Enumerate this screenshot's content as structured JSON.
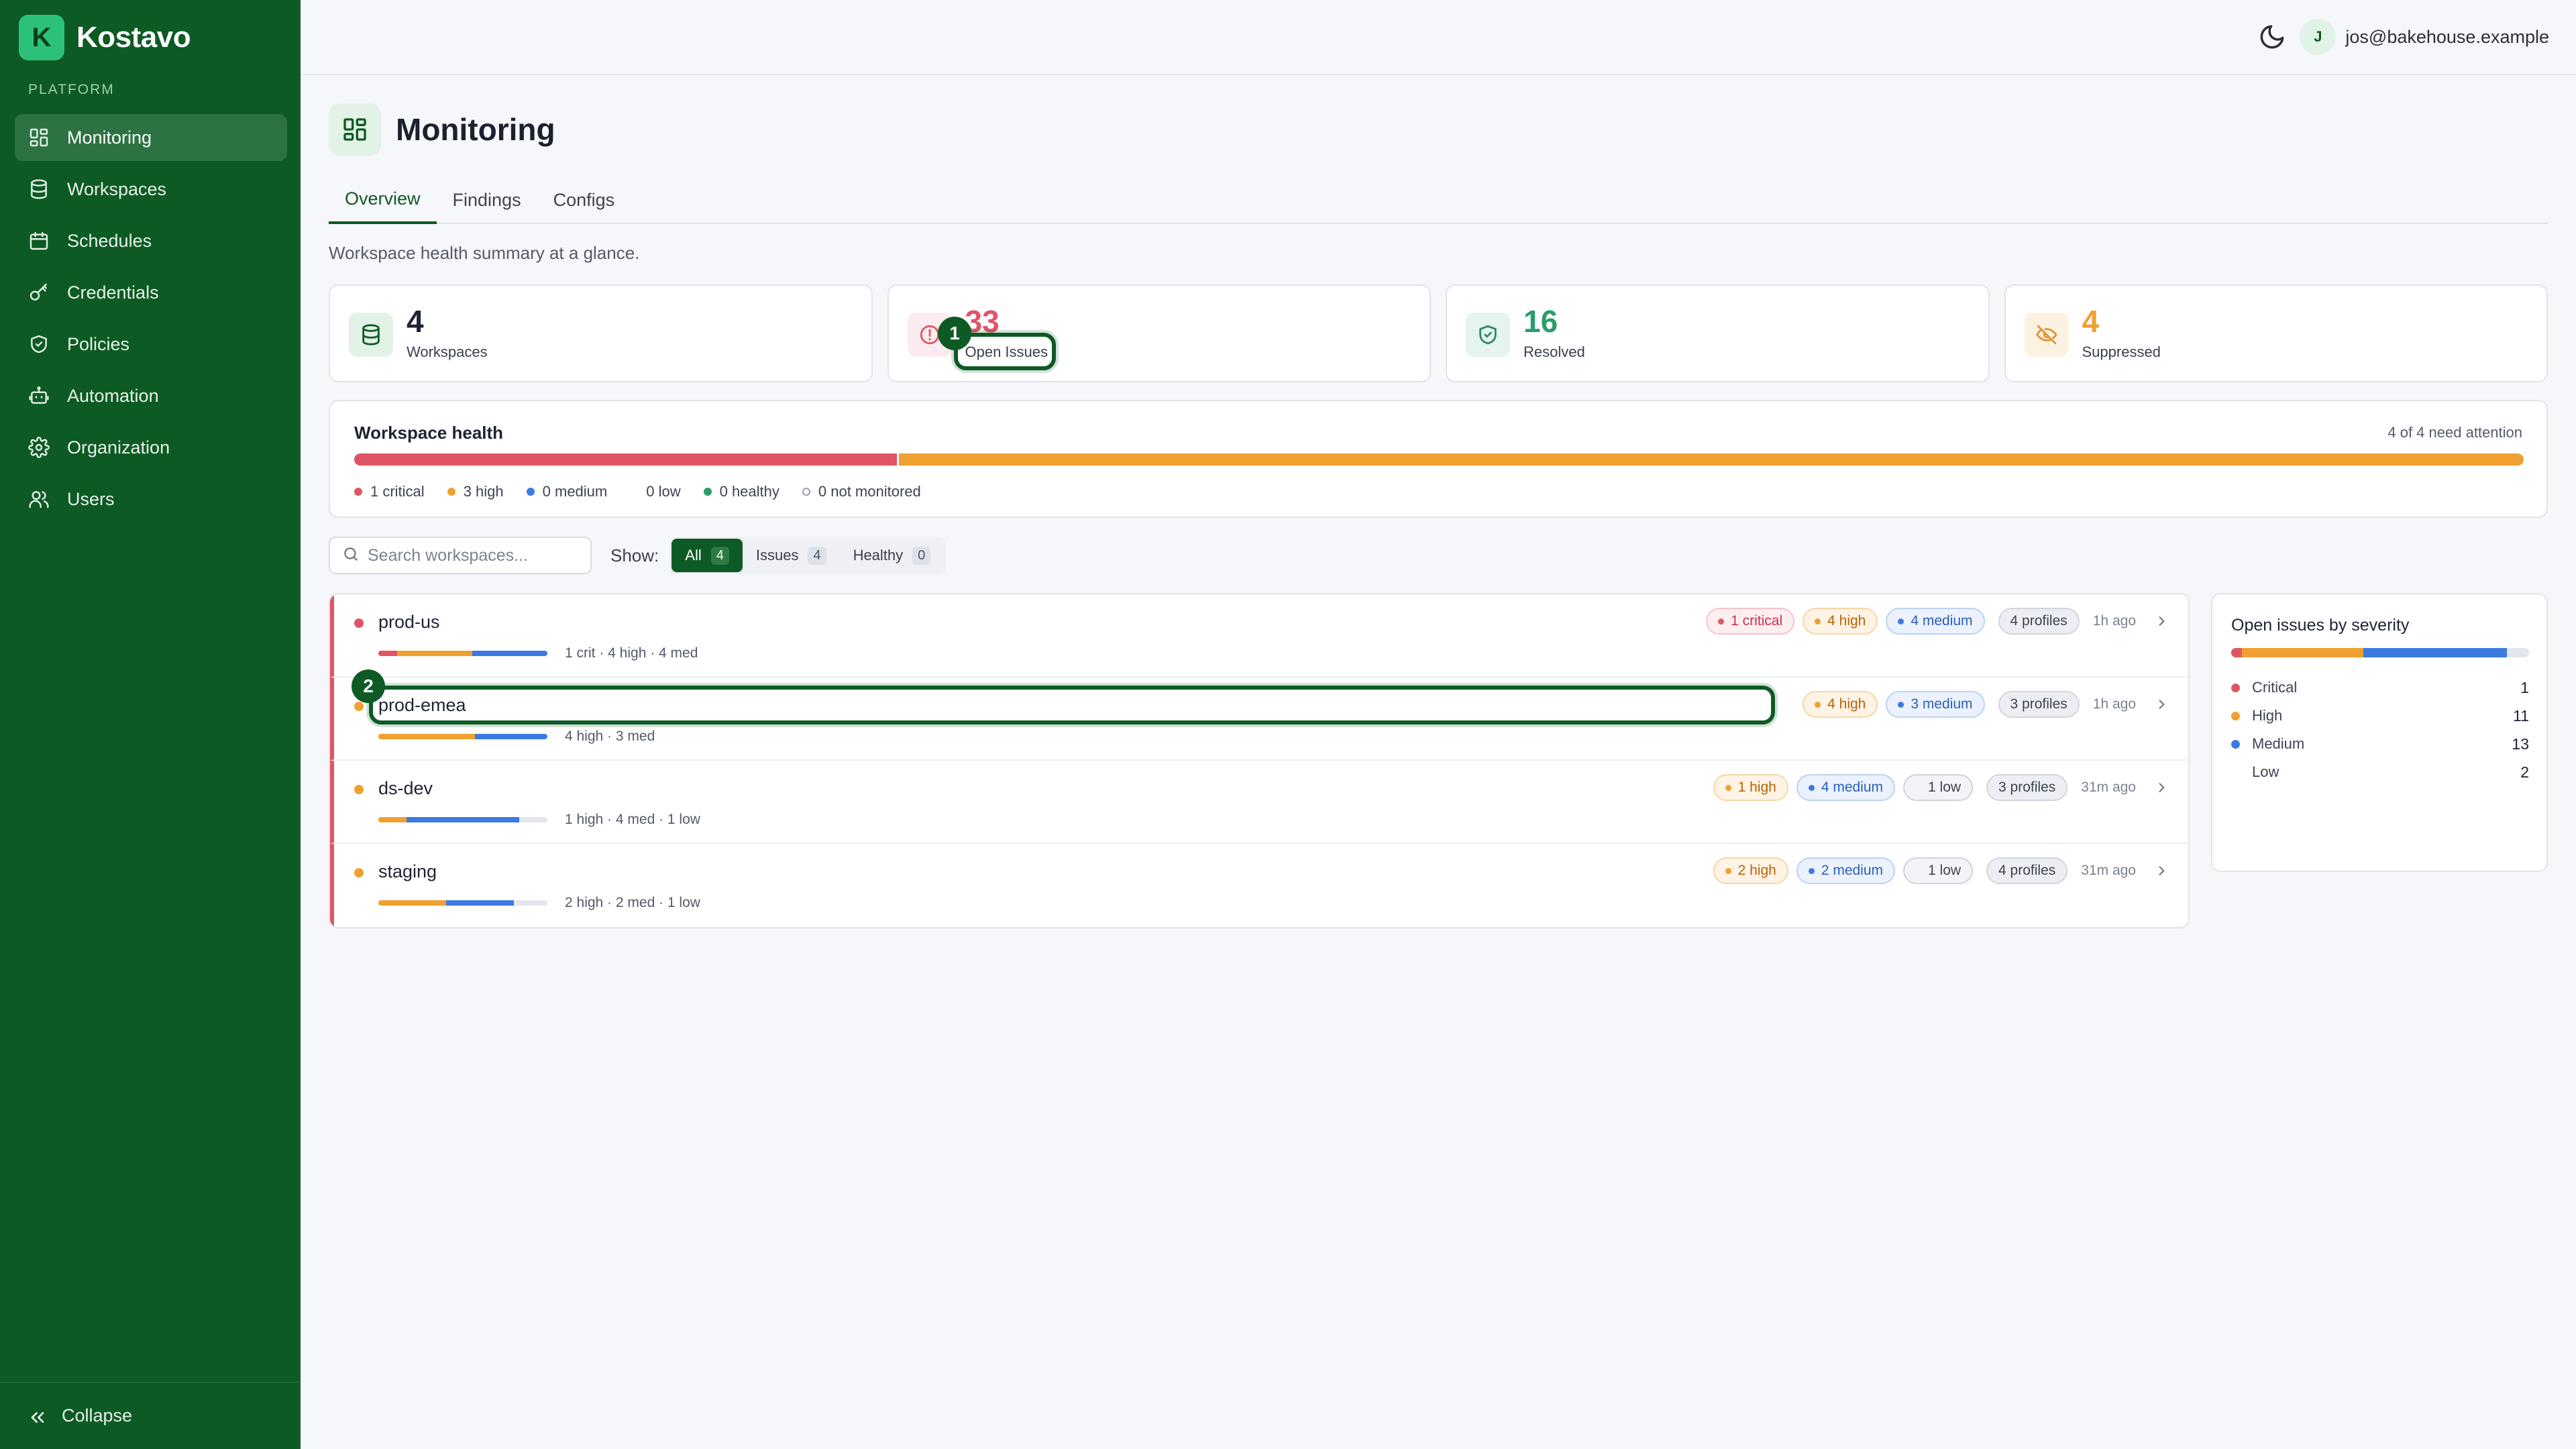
{
  "brand": {
    "logo_letter": "K",
    "name": "Kostavo"
  },
  "sidebar": {
    "section_label": "PLATFORM",
    "items": [
      {
        "label": "Monitoring",
        "icon": "grid-icon",
        "active": true
      },
      {
        "label": "Workspaces",
        "icon": "database-icon"
      },
      {
        "label": "Schedules",
        "icon": "calendar-icon"
      },
      {
        "label": "Credentials",
        "icon": "key-icon"
      },
      {
        "label": "Policies",
        "icon": "shield-icon"
      },
      {
        "label": "Automation",
        "icon": "robot-icon"
      },
      {
        "label": "Organization",
        "icon": "gear-icon"
      },
      {
        "label": "Users",
        "icon": "users-icon"
      }
    ],
    "collapse_label": "Collapse"
  },
  "topbar": {
    "avatar_initial": "J",
    "user_email": "jos@bakehouse.example"
  },
  "page": {
    "title": "Monitoring",
    "tabs": [
      "Overview",
      "Findings",
      "Configs"
    ],
    "subtitle": "Workspace health summary at a glance."
  },
  "stats": [
    {
      "value": "4",
      "label": "Workspaces",
      "color": "#1f2433"
    },
    {
      "value": "33",
      "label": "Open Issues",
      "color": "#e05566"
    },
    {
      "value": "16",
      "label": "Resolved",
      "color": "#2a9d6a"
    },
    {
      "value": "4",
      "label": "Suppressed",
      "color": "#f0a030"
    }
  ],
  "health": {
    "title": "Workspace health",
    "meta": "4 of 4 need attention",
    "segments": [
      {
        "key": "critical",
        "count": 1,
        "color": "#e05566"
      },
      {
        "key": "high",
        "count": 3,
        "color": "#f0a030"
      }
    ],
    "legend": [
      {
        "text": "1 critical",
        "color": "#e05566"
      },
      {
        "text": "3 high",
        "color": "#f0a030"
      },
      {
        "text": "0 medium",
        "color": "#3b7ae0"
      },
      {
        "text": "0 low",
        "color": ""
      },
      {
        "text": "0 healthy",
        "color": "#2a9d6a"
      },
      {
        "text": "0 not monitored",
        "color": "ring"
      }
    ]
  },
  "filters": {
    "search_placeholder": "Search workspaces...",
    "show_label": "Show:",
    "pills": [
      {
        "label": "All",
        "count": "4",
        "active": true
      },
      {
        "label": "Issues",
        "count": "4"
      },
      {
        "label": "Healthy",
        "count": "0"
      }
    ]
  },
  "workspaces": [
    {
      "name": "prod-us",
      "dot": "#e05566",
      "crit": 1,
      "high": 4,
      "med": 4,
      "low": 0,
      "summary": "1 crit · 4 high · 4 med",
      "badges": [
        {
          "type": "critical",
          "text": "1 critical"
        },
        {
          "type": "high",
          "text": "4 high"
        },
        {
          "type": "medium",
          "text": "4 medium"
        }
      ],
      "profiles": "4 profiles",
      "time": "1h ago"
    },
    {
      "name": "prod-emea",
      "dot": "#f0a030",
      "crit": 0,
      "high": 4,
      "med": 3,
      "low": 0,
      "summary": "4 high · 3 med",
      "badges": [
        {
          "type": "high",
          "text": "4 high"
        },
        {
          "type": "medium",
          "text": "3 medium"
        }
      ],
      "profiles": "3 profiles",
      "time": "1h ago"
    },
    {
      "name": "ds-dev",
      "dot": "#f0a030",
      "crit": 0,
      "high": 1,
      "med": 4,
      "low": 1,
      "summary": "1 high · 4 med · 1 low",
      "badges": [
        {
          "type": "high",
          "text": "1 high"
        },
        {
          "type": "medium",
          "text": "4 medium"
        },
        {
          "type": "low",
          "text": "1 low"
        }
      ],
      "profiles": "3 profiles",
      "time": "31m ago"
    },
    {
      "name": "staging",
      "dot": "#f0a030",
      "crit": 0,
      "high": 2,
      "med": 2,
      "low": 1,
      "summary": "2 high · 2 med · 1 low",
      "badges": [
        {
          "type": "high",
          "text": "2 high"
        },
        {
          "type": "medium",
          "text": "2 medium"
        },
        {
          "type": "low",
          "text": "1 low"
        }
      ],
      "profiles": "4 profiles",
      "time": "31m ago"
    }
  ],
  "severity": {
    "title": "Open issues by severity",
    "rows": [
      {
        "label": "Critical",
        "count": 1,
        "color": "#e05566"
      },
      {
        "label": "High",
        "count": 11,
        "color": "#f0a030"
      },
      {
        "label": "Medium",
        "count": 13,
        "color": "#3b7ae0"
      },
      {
        "label": "Low",
        "count": 2,
        "color": ""
      }
    ]
  },
  "annotations": [
    {
      "number": "1"
    },
    {
      "number": "2"
    }
  ]
}
